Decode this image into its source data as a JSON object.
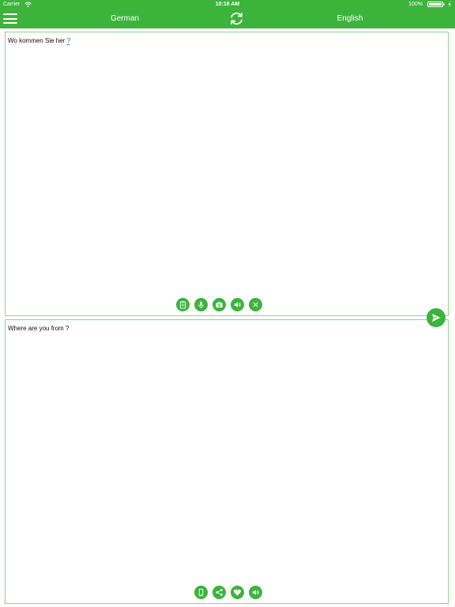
{
  "status_bar": {
    "carrier": "Carrier",
    "time": "10:16 AM",
    "battery_percent": "100%"
  },
  "nav": {
    "source_language": "German",
    "target_language": "English",
    "menu_icon": "hamburger-menu-icon",
    "swap_icon": "swap-languages-icon"
  },
  "input_panel": {
    "text": "Wo kommen Sie her",
    "text_tail": "?",
    "tools": [
      "clipboard-paste-icon",
      "microphone-icon",
      "camera-icon",
      "speaker-icon",
      "clear-icon"
    ]
  },
  "send_icon": "send-icon",
  "output_panel": {
    "text": "Where are you from ?",
    "tools": [
      "copy-icon",
      "share-icon",
      "heart-icon",
      "speaker-icon"
    ]
  },
  "colors": {
    "accent": "#3cb43c",
    "panel_border": "#8fd68f"
  }
}
